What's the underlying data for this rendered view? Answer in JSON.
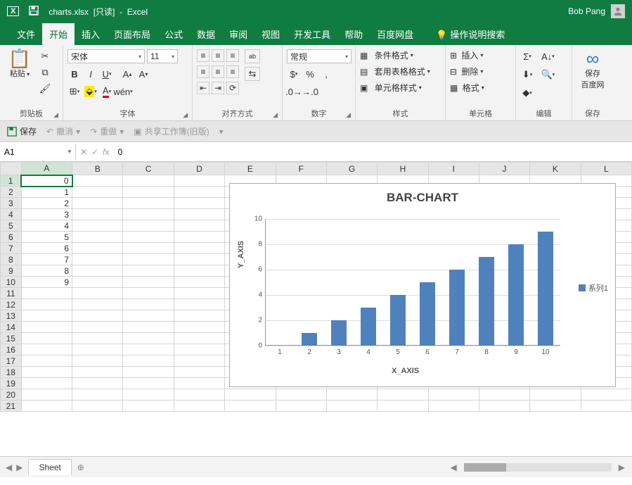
{
  "titlebar": {
    "filename": "charts.xlsx",
    "readonly_suffix": "[只读]",
    "appname": "Excel",
    "sep": "-",
    "username": "Bob Pang"
  },
  "tabs": [
    "文件",
    "开始",
    "插入",
    "页面布局",
    "公式",
    "数据",
    "审阅",
    "视图",
    "开发工具",
    "帮助",
    "百度网盘"
  ],
  "active_tab_index": 1,
  "tell_me": "操作说明搜索",
  "ribbon": {
    "clipboard": {
      "paste": "粘贴",
      "label": "剪贴板"
    },
    "font": {
      "name": "宋体",
      "size": "11",
      "label": "字体"
    },
    "align": {
      "label": "对齐方式"
    },
    "number": {
      "format": "常规",
      "label": "数字"
    },
    "styles": {
      "cond": "条件格式",
      "table": "套用表格格式",
      "cell": "单元格样式",
      "label": "样式"
    },
    "cells": {
      "insert": "插入",
      "delete": "删除",
      "format": "格式",
      "label": "单元格"
    },
    "editing": {
      "label": "编辑"
    },
    "save": {
      "label": "保存"
    }
  },
  "eq_toolbar": {
    "save": "保存",
    "undo": "撤消",
    "redo": "重做",
    "share": "共享工作簿(旧版)"
  },
  "fx": {
    "cell": "A1",
    "value": "0"
  },
  "columns": [
    "A",
    "B",
    "C",
    "D",
    "E",
    "F",
    "G",
    "H",
    "I",
    "J",
    "K",
    "L"
  ],
  "rows": 21,
  "cell_values": {
    "A1": "0",
    "A2": "1",
    "A3": "2",
    "A4": "3",
    "A5": "4",
    "A6": "5",
    "A7": "6",
    "A8": "7",
    "A9": "8",
    "A10": "9"
  },
  "chart_data": {
    "type": "bar",
    "title": "BAR-CHART",
    "xlabel": "X_AXIS",
    "ylabel": "Y_AXIS",
    "categories": [
      "1",
      "2",
      "3",
      "4",
      "5",
      "6",
      "7",
      "8",
      "9",
      "10"
    ],
    "values": [
      0,
      1,
      2,
      3,
      4,
      5,
      6,
      7,
      8,
      9
    ],
    "ylim": [
      0,
      10
    ],
    "yticks": [
      0,
      2,
      4,
      6,
      8,
      10
    ],
    "series_name": "系列1"
  },
  "sheet": {
    "name": "Sheet"
  }
}
